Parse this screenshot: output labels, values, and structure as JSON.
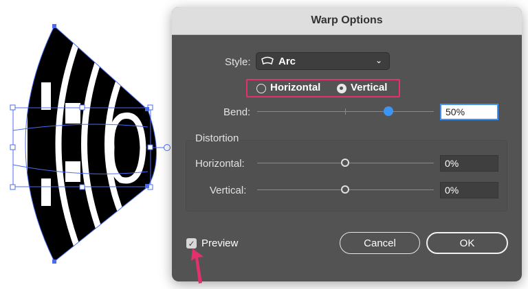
{
  "dialog": {
    "title": "Warp Options",
    "style_label": "Style:",
    "style_value": "Arc",
    "style_icon": "arc-warp-icon",
    "orientation": {
      "horizontal_label": "Horizontal",
      "vertical_label": "Vertical",
      "selected": "Vertical"
    },
    "bend": {
      "label": "Bend:",
      "value": "50%",
      "fraction": 0.5
    },
    "distortion": {
      "section_label": "Distortion",
      "horizontal": {
        "label": "Horizontal:",
        "value": "0%",
        "fraction": 0.0
      },
      "vertical": {
        "label": "Vertical:",
        "value": "0%",
        "fraction": 0.0
      }
    },
    "preview": {
      "label": "Preview",
      "checked": true
    },
    "buttons": {
      "cancel": "Cancel",
      "ok": "OK"
    }
  },
  "colors": {
    "dialog_bg": "#535353",
    "titlebar_bg": "#dedede",
    "accent_blue": "#3e94f4",
    "highlight_pink": "#e5306f",
    "selection_outline": "#4a6cf0"
  }
}
